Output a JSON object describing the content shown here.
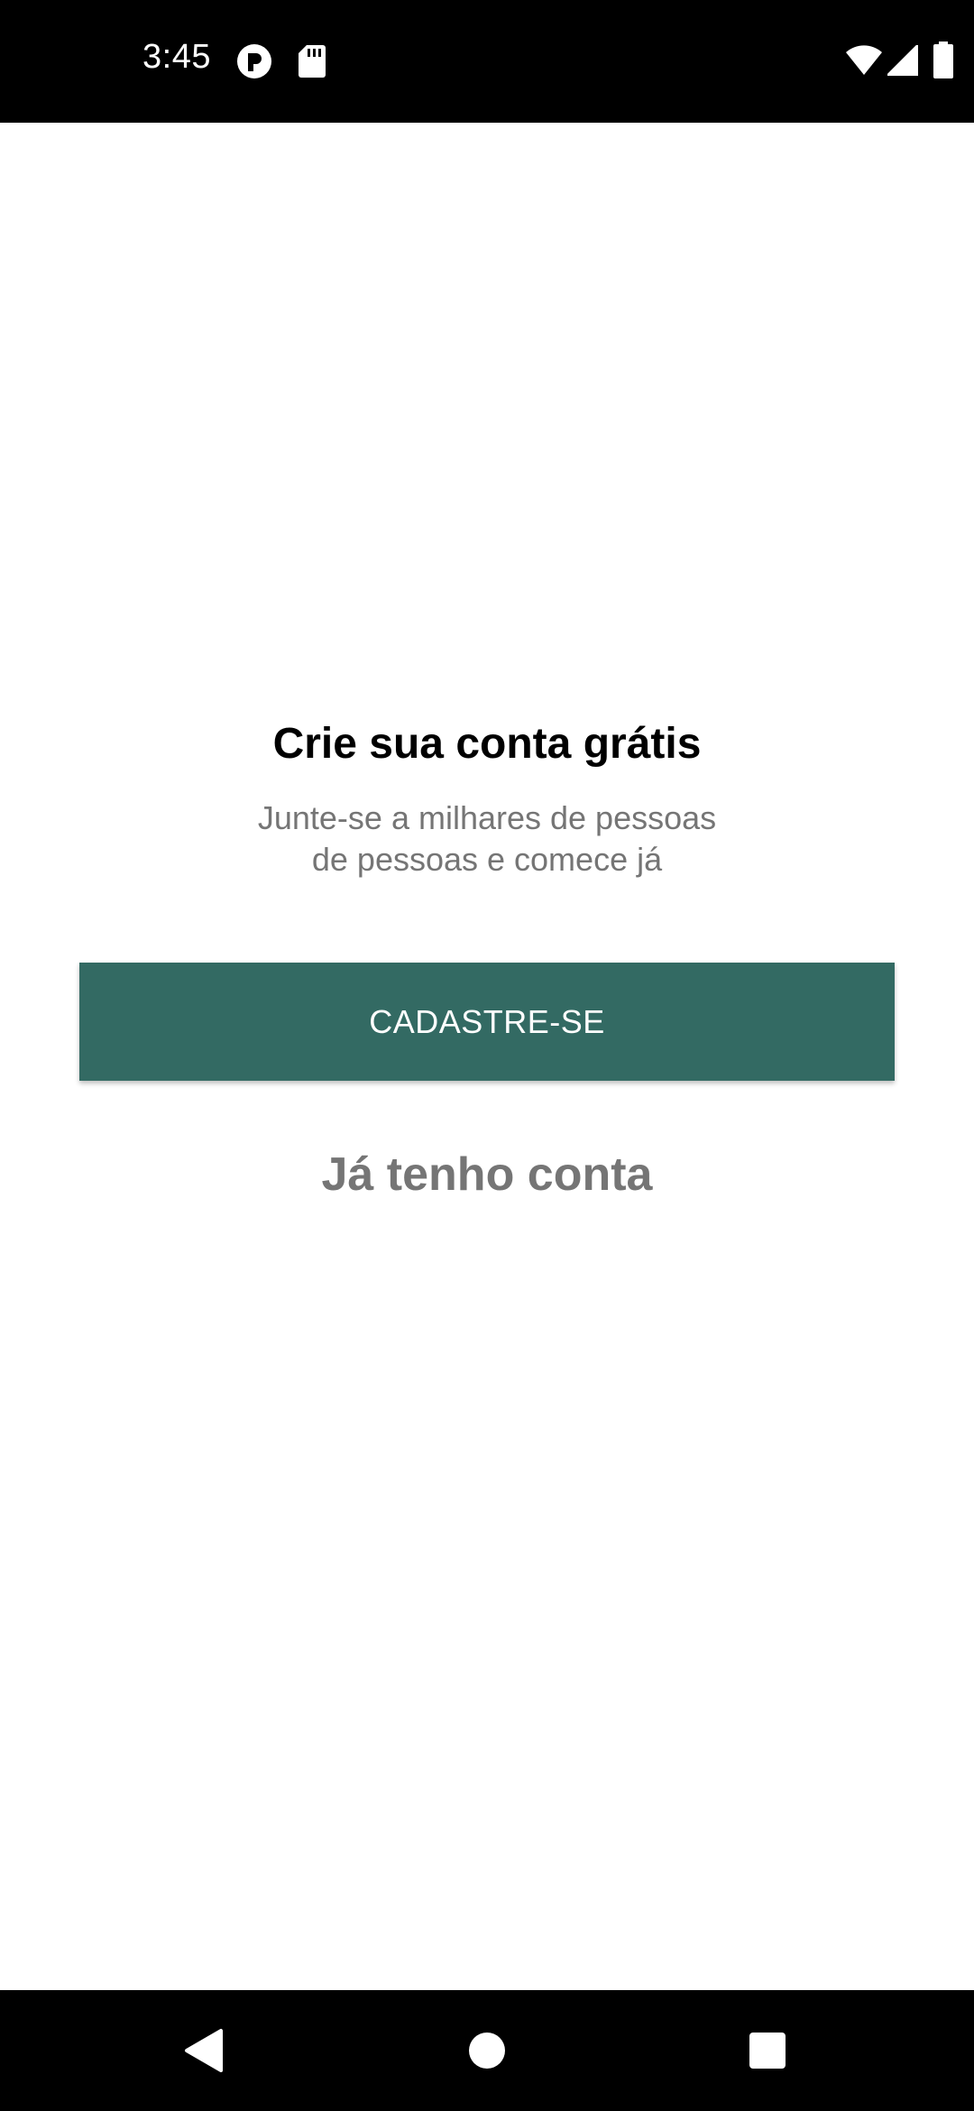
{
  "status_bar": {
    "time": "3:45",
    "icons": [
      "notification-badge-icon",
      "sd-card-icon",
      "wifi-icon",
      "cellular-signal-icon",
      "battery-icon"
    ]
  },
  "signup": {
    "title": "Crie sua conta grátis",
    "subtitle_line1": "Junte-se a milhares de pessoas",
    "subtitle_line2": "de pessoas e comece já",
    "signup_button_label": "CADASTRE-SE",
    "login_link_label": "Já tenho conta"
  },
  "nav_bar": {
    "buttons": [
      "back-icon",
      "home-icon",
      "recents-icon"
    ]
  },
  "colors": {
    "accent": "#336a63",
    "secondary_text": "#757575",
    "title_text": "#000000",
    "bars": "#000000"
  }
}
